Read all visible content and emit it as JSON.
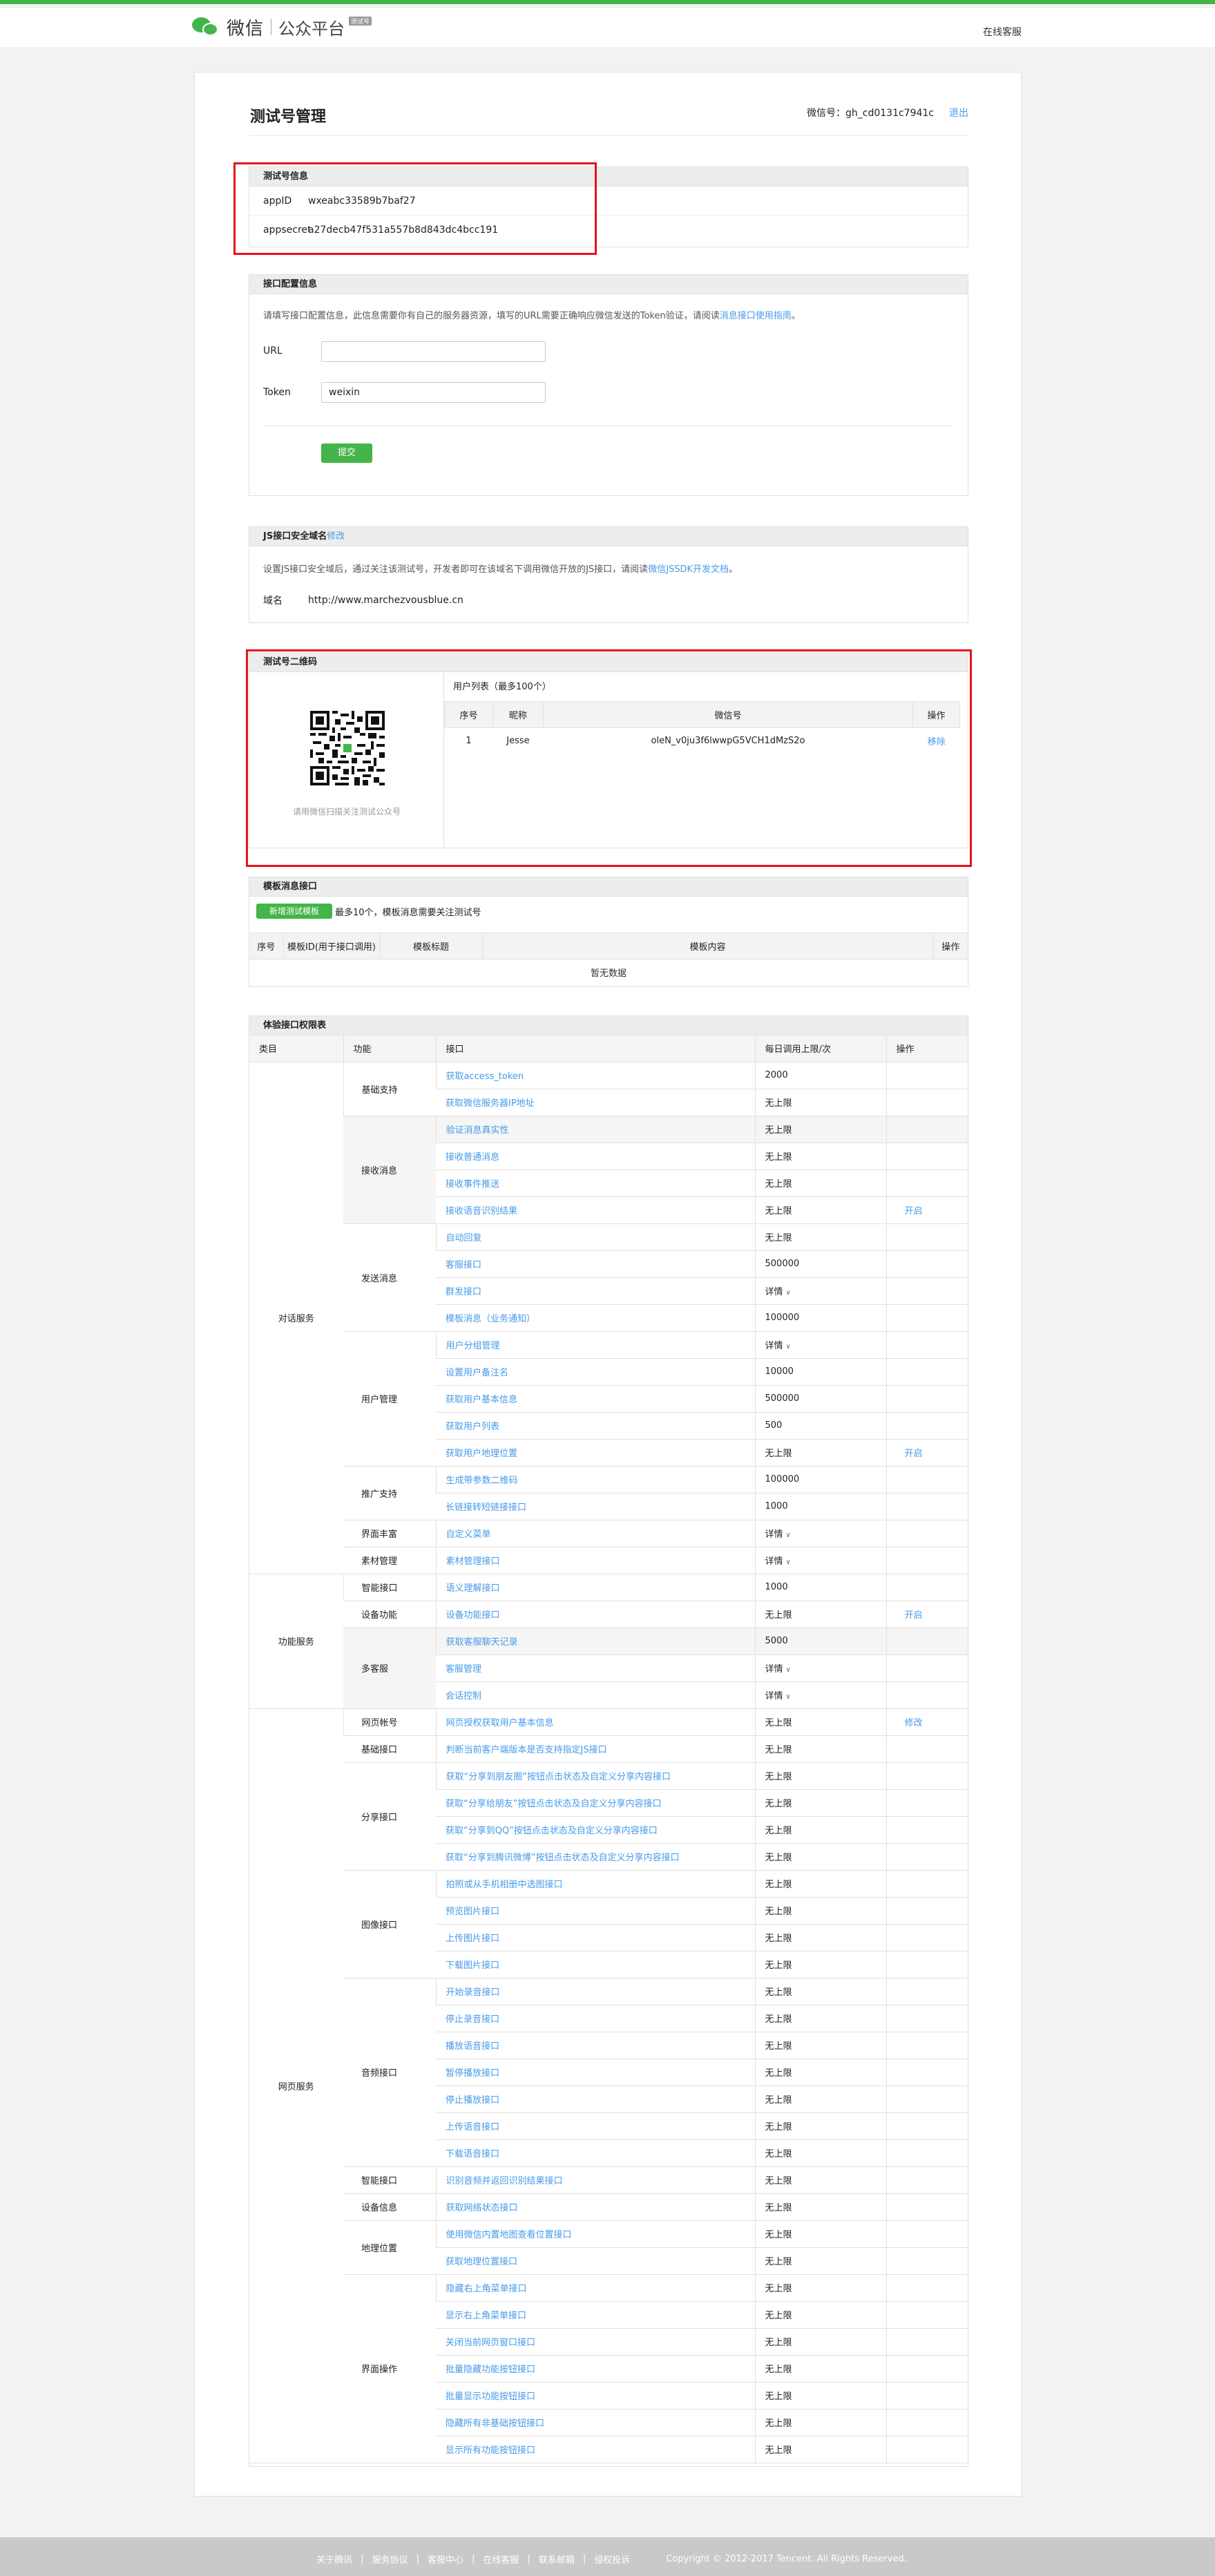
{
  "header": {
    "logo_text": "微信",
    "logo_sub": "公众平台",
    "logo_badge": "测试号",
    "help_link": "在线客服"
  },
  "page": {
    "title": "测试号管理",
    "account_label": "微信号：",
    "account_value": "gh_cd0131c7941c",
    "logout": "退出"
  },
  "test_info": {
    "title": "测试号信息",
    "appid_label": "appID",
    "appid_value": "wxeabc33589b7baf27",
    "secret_label": "appsecret",
    "secret_value": "a27decb47f531a557b8d843dc4bcc191"
  },
  "interface_config": {
    "title": "接口配置信息",
    "desc": "请填写接口配置信息，此信息需要你有自己的服务器资源，填写的URL需要正确响应微信发送的Token验证，请阅读",
    "desc_link": "消息接口使用指南",
    "desc_end": "。",
    "url_label": "URL",
    "url_value": "",
    "token_label": "Token",
    "token_value": "weixin",
    "submit": "提交"
  },
  "js_domain": {
    "title": "JS接口安全域名",
    "modify": "修改",
    "desc": "设置JS接口安全域后，通过关注该测试号，开发者即可在该域名下调用微信开放的JS接口，请阅读",
    "desc_link": "微信JSSDK开发文档",
    "desc_end": "。",
    "domain_label": "域名",
    "domain_value": "http://www.marchezvousblue.cn"
  },
  "qrcode": {
    "title": "测试号二维码",
    "caption": "请用微信扫描关注测试公众号",
    "user_list_title": "用户列表（最多100个）",
    "columns": [
      "序号",
      "昵称",
      "微信号",
      "操作"
    ],
    "rows": [
      {
        "no": "1",
        "nickname": "Jesse",
        "wechat_id": "oleN_v0ju3f6lwwpG5VCH1dMzS2o",
        "action": "移除"
      }
    ]
  },
  "template": {
    "title": "模板消息接口",
    "add_button": "新增测试模板",
    "note": "最多10个，模板消息需要关注测试号",
    "columns": [
      "序号",
      "模板ID(用于接口调用)",
      "模板标题",
      "模板内容",
      "操作"
    ],
    "empty": "暂无数据"
  },
  "permissions": {
    "title": "体验接口权限表",
    "columns": [
      "类目",
      "功能",
      "接口",
      "每日调用上限/次",
      "操作"
    ],
    "categories": [
      {
        "name": "对话服务",
        "groups": [
          {
            "name": "基础支持",
            "items": [
              {
                "api": "获取access_token",
                "limit": "2000",
                "op": ""
              },
              {
                "api": "获取微信服务器IP地址",
                "limit": "无上限",
                "op": ""
              }
            ]
          },
          {
            "name": "接收消息",
            "items": [
              {
                "api": "验证消息真实性",
                "limit": "无上限",
                "op": ""
              },
              {
                "api": "接收普通消息",
                "limit": "无上限",
                "op": ""
              },
              {
                "api": "接收事件推送",
                "limit": "无上限",
                "op": ""
              },
              {
                "api": "接收语音识别结果",
                "limit": "无上限",
                "op": "开启"
              }
            ]
          },
          {
            "name": "发送消息",
            "items": [
              {
                "api": "自动回复",
                "limit": "无上限",
                "op": ""
              },
              {
                "api": "客服接口",
                "limit": "500000",
                "op": ""
              },
              {
                "api": "群发接口",
                "limit": "详情",
                "op": ""
              },
              {
                "api": "模板消息（业务通知）",
                "limit": "100000",
                "op": ""
              }
            ]
          },
          {
            "name": "用户管理",
            "items": [
              {
                "api": "用户分组管理",
                "limit": "详情",
                "op": ""
              },
              {
                "api": "设置用户备注名",
                "limit": "10000",
                "op": ""
              },
              {
                "api": "获取用户基本信息",
                "limit": "500000",
                "op": ""
              },
              {
                "api": "获取用户列表",
                "limit": "500",
                "op": ""
              },
              {
                "api": "获取用户地理位置",
                "limit": "无上限",
                "op": "开启"
              }
            ]
          },
          {
            "name": "推广支持",
            "items": [
              {
                "api": "生成带参数二维码",
                "limit": "100000",
                "op": ""
              },
              {
                "api": "长链接转短链接接口",
                "limit": "1000",
                "op": ""
              }
            ]
          },
          {
            "name": "界面丰富",
            "items": [
              {
                "api": "自定义菜单",
                "limit": "详情",
                "op": ""
              }
            ]
          },
          {
            "name": "素材管理",
            "items": [
              {
                "api": "素材管理接口",
                "limit": "详情",
                "op": ""
              }
            ]
          }
        ]
      },
      {
        "name": "功能服务",
        "groups": [
          {
            "name": "智能接口",
            "items": [
              {
                "api": "语义理解接口",
                "limit": "1000",
                "op": ""
              }
            ]
          },
          {
            "name": "设备功能",
            "items": [
              {
                "api": "设备功能接口",
                "limit": "无上限",
                "op": "开启"
              }
            ]
          },
          {
            "name": "多客服",
            "items": [
              {
                "api": "获取客服聊天记录",
                "limit": "5000",
                "op": ""
              },
              {
                "api": "客服管理",
                "limit": "详情",
                "op": ""
              },
              {
                "api": "会话控制",
                "limit": "详情",
                "op": ""
              }
            ]
          }
        ]
      },
      {
        "name": "网页服务",
        "groups": [
          {
            "name": "网页帐号",
            "items": [
              {
                "api": "网页授权获取用户基本信息",
                "limit": "无上限",
                "op": "修改"
              }
            ]
          },
          {
            "name": "基础接口",
            "items": [
              {
                "api": "判断当前客户端版本是否支持指定JS接口",
                "limit": "无上限",
                "op": ""
              }
            ]
          },
          {
            "name": "分享接口",
            "items": [
              {
                "api": "获取“分享到朋友圈”按钮点击状态及自定义分享内容接口",
                "limit": "无上限",
                "op": ""
              },
              {
                "api": "获取“分享给朋友”按钮点击状态及自定义分享内容接口",
                "limit": "无上限",
                "op": ""
              },
              {
                "api": "获取“分享到QQ”按钮点击状态及自定义分享内容接口",
                "limit": "无上限",
                "op": ""
              },
              {
                "api": "获取“分享到腾讯微博”按钮点击状态及自定义分享内容接口",
                "limit": "无上限",
                "op": ""
              }
            ]
          },
          {
            "name": "图像接口",
            "items": [
              {
                "api": "拍照或从手机相册中选图接口",
                "limit": "无上限",
                "op": ""
              },
              {
                "api": "预览图片接口",
                "limit": "无上限",
                "op": ""
              },
              {
                "api": "上传图片接口",
                "limit": "无上限",
                "op": ""
              },
              {
                "api": "下载图片接口",
                "limit": "无上限",
                "op": ""
              }
            ]
          },
          {
            "name": "音频接口",
            "items": [
              {
                "api": "开始录音接口",
                "limit": "无上限",
                "op": ""
              },
              {
                "api": "停止录音接口",
                "limit": "无上限",
                "op": ""
              },
              {
                "api": "播放语音接口",
                "limit": "无上限",
                "op": ""
              },
              {
                "api": "暂停播放接口",
                "limit": "无上限",
                "op": ""
              },
              {
                "api": "停止播放接口",
                "limit": "无上限",
                "op": ""
              },
              {
                "api": "上传语音接口",
                "limit": "无上限",
                "op": ""
              },
              {
                "api": "下载语音接口",
                "limit": "无上限",
                "op": ""
              }
            ]
          },
          {
            "name": "智能接口",
            "items": [
              {
                "api": "识别音频并返回识别结果接口",
                "limit": "无上限",
                "op": ""
              }
            ]
          },
          {
            "name": "设备信息",
            "items": [
              {
                "api": "获取网络状态接口",
                "limit": "无上限",
                "op": ""
              }
            ]
          },
          {
            "name": "地理位置",
            "items": [
              {
                "api": "使用微信内置地图查看位置接口",
                "limit": "无上限",
                "op": ""
              },
              {
                "api": "获取地理位置接口",
                "limit": "无上限",
                "op": ""
              }
            ]
          },
          {
            "name": "界面操作",
            "items": [
              {
                "api": "隐藏右上角菜单接口",
                "limit": "无上限",
                "op": ""
              },
              {
                "api": "显示右上角菜单接口",
                "limit": "无上限",
                "op": ""
              },
              {
                "api": "关闭当前网页窗口接口",
                "limit": "无上限",
                "op": ""
              },
              {
                "api": "批量隐藏功能按钮接口",
                "limit": "无上限",
                "op": ""
              },
              {
                "api": "批量显示功能按钮接口",
                "limit": "无上限",
                "op": ""
              },
              {
                "api": "隐藏所有非基础按钮接口",
                "limit": "无上限",
                "op": ""
              },
              {
                "api": "显示所有功能按钮接口",
                "limit": "无上限",
                "op": ""
              }
            ]
          }
        ]
      }
    ]
  },
  "footer": {
    "links": [
      "关于腾讯",
      "服务协议",
      "客服中心",
      "在线客服",
      "联系邮箱",
      "侵权投诉"
    ],
    "copyright": "Copyright © 2012-2017 Tencent. All Rights Reserved."
  }
}
